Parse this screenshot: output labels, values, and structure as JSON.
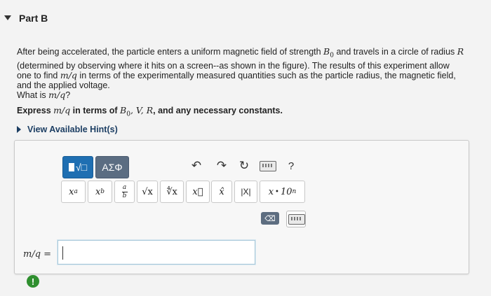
{
  "part": {
    "title": "Part B"
  },
  "question": {
    "seg1": "After being accelerated, the particle enters a uniform magnetic field of strength ",
    "b_sym": "B",
    "b_sub": "0",
    "seg2": " and travels in a circle of radius ",
    "r_sym": "R",
    "seg3": " (determined by observing where it hits on a screen--as shown in the figure). The results of this experiment allow one to find ",
    "mq": "m/q",
    "seg4": " in terms of the experimentally measured quantities such as the particle radius, the magnetic field, and the applied voltage.",
    "ask_prefix": "What is ",
    "ask_math": "m/q",
    "ask_suffix": "?"
  },
  "express": {
    "prefix": "Express ",
    "math": "m/q",
    "mid": " in terms of ",
    "vars": "B",
    "vars_sub": "0",
    "vars_rest": ", V, R",
    "suffix": ", and any necessary constants."
  },
  "hints": {
    "label": "View Available Hint(s)"
  },
  "toolbar": {
    "template_label": "√□",
    "greek_label": "ΑΣΦ",
    "undo": "↶",
    "redo": "↷",
    "reset": "↻",
    "help": "?"
  },
  "templates": {
    "power_base": "x",
    "power_exp": "a",
    "sub_base": "x",
    "sub_index": "b",
    "frac_num": "a",
    "frac_den": "b",
    "sqrt": "√x",
    "nroot": "∜x",
    "vector": "x⃗",
    "unit_vector": "x̂",
    "abs": "|X|",
    "sci_prefix": "x",
    "sci_dot": "•",
    "sci_base": "10",
    "sci_exp": "n"
  },
  "editor": {
    "backspace": "⌫"
  },
  "answer": {
    "label": "m/q =",
    "value": ""
  },
  "status": {
    "alert": "!"
  },
  "colors": {
    "active_button": "#1f6fb2",
    "toolbar_button": "#5b6d82",
    "hint_link": "#1c3e63",
    "alert": "#2f8f2f"
  },
  "icons": [
    "caret-down-icon",
    "caret-right-icon",
    "undo-icon",
    "redo-icon",
    "reset-icon",
    "keyboard-icon",
    "help-icon",
    "backspace-icon",
    "alert-icon"
  ]
}
